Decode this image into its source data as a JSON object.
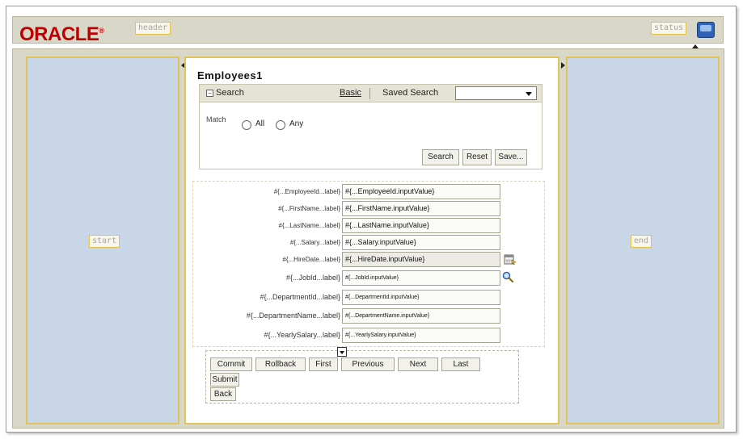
{
  "header": {
    "logo_text": "ORACLE",
    "logo_mark": "®",
    "facet_label": "header",
    "status_label": "status",
    "status_icon": "monitor-icon",
    "brand_color": "#c00000"
  },
  "layout": {
    "start_label": "start",
    "end_label": "end"
  },
  "page": {
    "title": "Employees1"
  },
  "search": {
    "title": "Search",
    "basic_link": "Basic",
    "saved_search_label": "Saved Search",
    "saved_search_value": "",
    "match_label": "Match",
    "match_options": [
      "All",
      "Any"
    ],
    "search_button": "Search",
    "reset_button": "Reset",
    "save_button": "Save..."
  },
  "form": {
    "fields": [
      {
        "label": "#{...EmployeeId...label}",
        "value": "#{...EmployeeId.inputValue}"
      },
      {
        "label": "#{...FirstName...label}",
        "value": "#{...FirstName.inputValue}"
      },
      {
        "label": "#{...LastName...label}",
        "value": "#{...LastName.inputValue}"
      },
      {
        "label": "#{...Salary...label}",
        "value": "#{...Salary.inputValue}"
      },
      {
        "label": "#{...HireDate...label}",
        "value": "#{...HireDate.inputValue}",
        "icon": "calendar-icon"
      },
      {
        "label": "#{...JobId...label}",
        "value": "#{...JobId.inputValue}",
        "icon": "search-icon"
      },
      {
        "label": "#{...DepartmentId...label}",
        "value": "#{...DepartmentId.inputValue}"
      },
      {
        "label": "#{...DepartmentName...label}",
        "value": "#{...DepartmentName.inputValue}"
      },
      {
        "label": "#{...YearlySalary...label}",
        "value": "#{...YearlySalary.inputValue}"
      }
    ]
  },
  "navigation": {
    "commit": "Commit",
    "rollback": "Rollback",
    "first": "First",
    "previous": "Previous",
    "next": "Next",
    "last": "Last",
    "submit": "Submit",
    "back": "Back"
  }
}
